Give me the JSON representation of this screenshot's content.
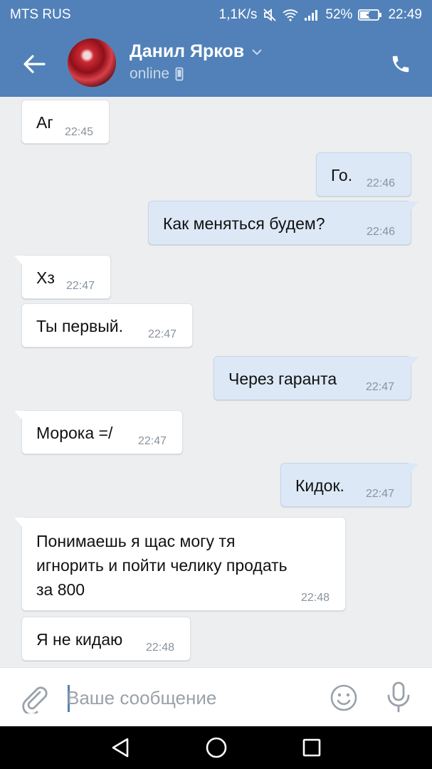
{
  "status_bar": {
    "carrier": "MTS RUS",
    "speed": "1,1K/s",
    "battery": "52%",
    "time": "22:49"
  },
  "header": {
    "name": "Данил Ярков",
    "status": "online"
  },
  "messages": [
    {
      "direction": "in",
      "text": "Аг",
      "time": "22:45"
    },
    {
      "direction": "out",
      "text": "Го.",
      "time": "22:46"
    },
    {
      "direction": "out",
      "text": "Как меняться будем?",
      "time": "22:46"
    },
    {
      "direction": "in",
      "text": "Хз",
      "time": "22:47"
    },
    {
      "direction": "in",
      "text": "Ты первый.",
      "time": "22:47"
    },
    {
      "direction": "out",
      "text": "Через гаранта",
      "time": "22:47"
    },
    {
      "direction": "in",
      "text": "Морока =/",
      "time": "22:47"
    },
    {
      "direction": "out",
      "text": "Кидок.",
      "time": "22:47"
    },
    {
      "direction": "in",
      "lines": [
        "Понимаешь я щас могу тя",
        "игнорить и пойти челику продать",
        "за 800"
      ],
      "time": "22:48"
    },
    {
      "direction": "in",
      "text": "Я не кидаю",
      "time": "22:48"
    }
  ],
  "input": {
    "placeholder": "Ваше сообщение"
  },
  "colors": {
    "header": "#5181b8",
    "incoming_bubble": "#ffffff",
    "outgoing_bubble": "#dce8f6",
    "chat_background": "#edeef0"
  }
}
